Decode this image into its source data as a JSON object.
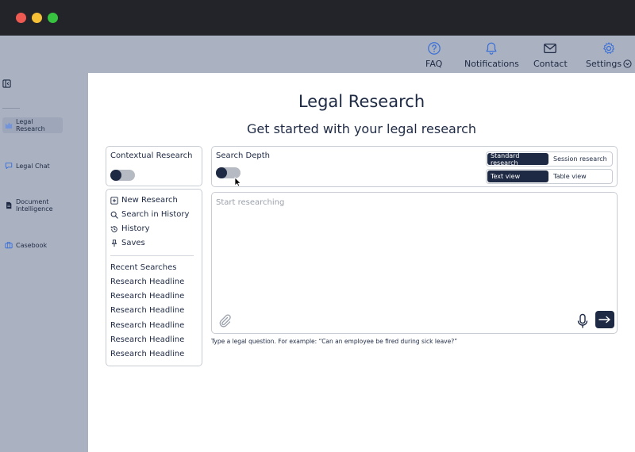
{
  "window": {
    "controls": [
      "close",
      "minimize",
      "maximize"
    ]
  },
  "topnav": {
    "faq": {
      "label": "FAQ",
      "icon": "question-circle-icon"
    },
    "notifications": {
      "label": "Notifications",
      "icon": "bell-icon"
    },
    "contact": {
      "label": "Contact",
      "icon": "envelope-icon"
    },
    "settings": {
      "label": "Settings",
      "icon": "gear-icon"
    }
  },
  "sidebar": {
    "items": [
      {
        "label": "Legal Research",
        "icon": "research-chart-icon",
        "active": true
      },
      {
        "label": "Legal Chat",
        "icon": "chat-bubble-icon",
        "active": false
      },
      {
        "label": "Document Intelligence",
        "icon": "document-icon",
        "active": false
      },
      {
        "label": "Casebook",
        "icon": "briefcase-icon",
        "active": false
      }
    ]
  },
  "main": {
    "title": "Legal Research",
    "subtitle": "Get started with your legal research",
    "contextual": {
      "title": "Contextual Research",
      "enabled": false
    },
    "nav": {
      "new_research": "New Research",
      "search_history": "Search in History",
      "history": "History",
      "saves": "Saves"
    },
    "recent": {
      "title": "Recent Searches",
      "items": [
        "Research Headline",
        "Research Headline",
        "Research Headline",
        "Research Headline",
        "Research Headline",
        "Research Headline"
      ]
    },
    "search_depth": {
      "title": "Search Depth",
      "enabled": false
    },
    "mode": {
      "options": [
        "Standard research",
        "Session research"
      ],
      "selected": "Standard research"
    },
    "view": {
      "options": [
        "Text view",
        "Table view"
      ],
      "selected": "Text view"
    },
    "input": {
      "placeholder": "Start researching",
      "value": ""
    },
    "hint": "Type a legal question. For example: “Can an employee be fired during sick leave?”"
  },
  "colors": {
    "accent": "#1e2a44",
    "chrome": "#aab2c2",
    "titlebar": "#222429",
    "icon_blue": "#3b6fd6"
  }
}
